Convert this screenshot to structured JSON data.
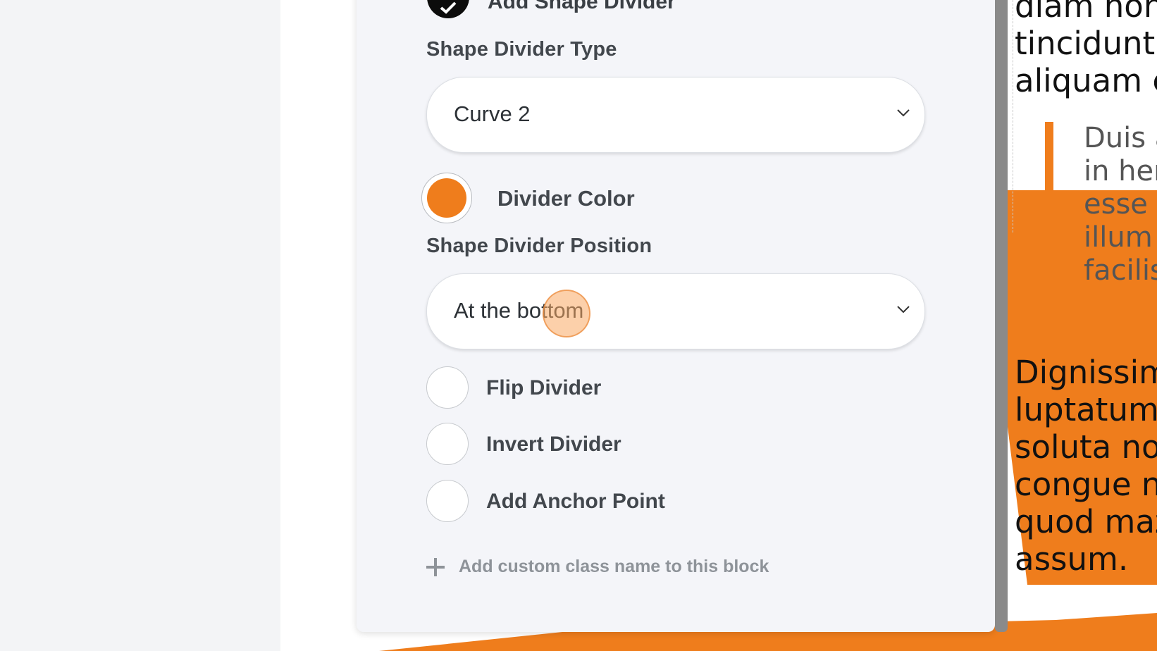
{
  "colors": {
    "accent": "#ef7d1c",
    "panel_bg": "#f4f5f9",
    "text": "#42474d"
  },
  "settings_panel": {
    "toggle_label": "Add Shape Divider",
    "type_label": "Shape Divider Type",
    "type_value": "Curve 2",
    "color_label": "Divider Color",
    "color_value": "#ef7d1c",
    "position_label": "Shape Divider Position",
    "position_value": "At the bottom",
    "flip_label": "Flip Divider",
    "invert_label": "Invert Divider",
    "anchor_label": "Add Anchor Point",
    "custom_class_label": "Add custom class name to this block"
  },
  "preview": {
    "top_lines": [
      "diam non",
      "tincidunt u",
      "aliquam e"
    ],
    "quote_lines": [
      "Duis a",
      "in hen",
      "esse m",
      "illum d",
      "facilis"
    ],
    "body_lines": [
      "Dignissim",
      "luptatum l",
      "soluta nob",
      "congue ni",
      "quod maz",
      "assum."
    ]
  }
}
